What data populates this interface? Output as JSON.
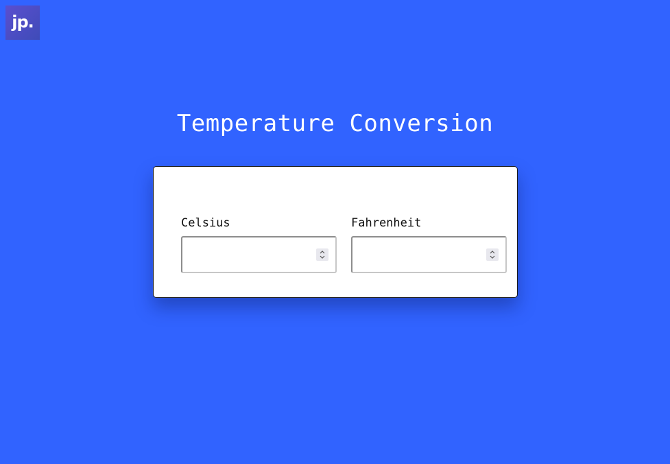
{
  "logo": {
    "text": "jp."
  },
  "page": {
    "title": "Temperature Conversion"
  },
  "converter": {
    "celsius": {
      "label": "Celsius",
      "value": ""
    },
    "fahrenheit": {
      "label": "Fahrenheit",
      "value": ""
    }
  },
  "icons": {
    "celsius_spinner": "spinner-icon",
    "fahrenheit_spinner": "spinner-icon"
  },
  "colors": {
    "background": "#3163ff",
    "card": "#ffffff",
    "logo": "#4f4dc4"
  }
}
